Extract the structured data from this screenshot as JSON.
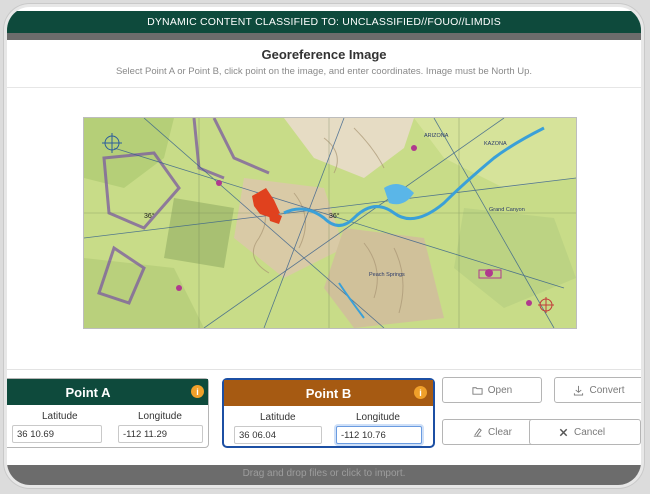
{
  "banner": {
    "text": "DYNAMIC CONTENT CLASSIFIED TO: UNCLASSIFIED//FOUO//LIMDIS"
  },
  "modal": {
    "title": "Georeference Image",
    "subtitle": "Select Point A or Point B, click point on the image, and enter coordinates. Image must be North Up."
  },
  "map": {
    "labels": {
      "arizona": "ARIZONA",
      "kazona": "KAZONA",
      "grand_canyon": "Grand Canyon",
      "peach_springs": "Peach Springs",
      "lat36": "36°"
    }
  },
  "point_a": {
    "title": "Point A",
    "lat_label": "Latitude",
    "lon_label": "Longitude",
    "lat": "36 10.69",
    "lon": "-112 11.29"
  },
  "point_b": {
    "title": "Point B",
    "lat_label": "Latitude",
    "lon_label": "Longitude",
    "lat": "36 06.04",
    "lon": "-112 10.76"
  },
  "buttons": {
    "open": "Open",
    "convert": "Convert",
    "clear": "Clear",
    "cancel": "Cancel"
  },
  "dropzone": {
    "text": "Drag and drop files or click to import."
  },
  "colors": {
    "banner": "#0e4a3c",
    "point_a": "#0e4a3c",
    "point_b": "#a65a12",
    "focus": "#1c4fa3",
    "info": "#f0a02a"
  }
}
